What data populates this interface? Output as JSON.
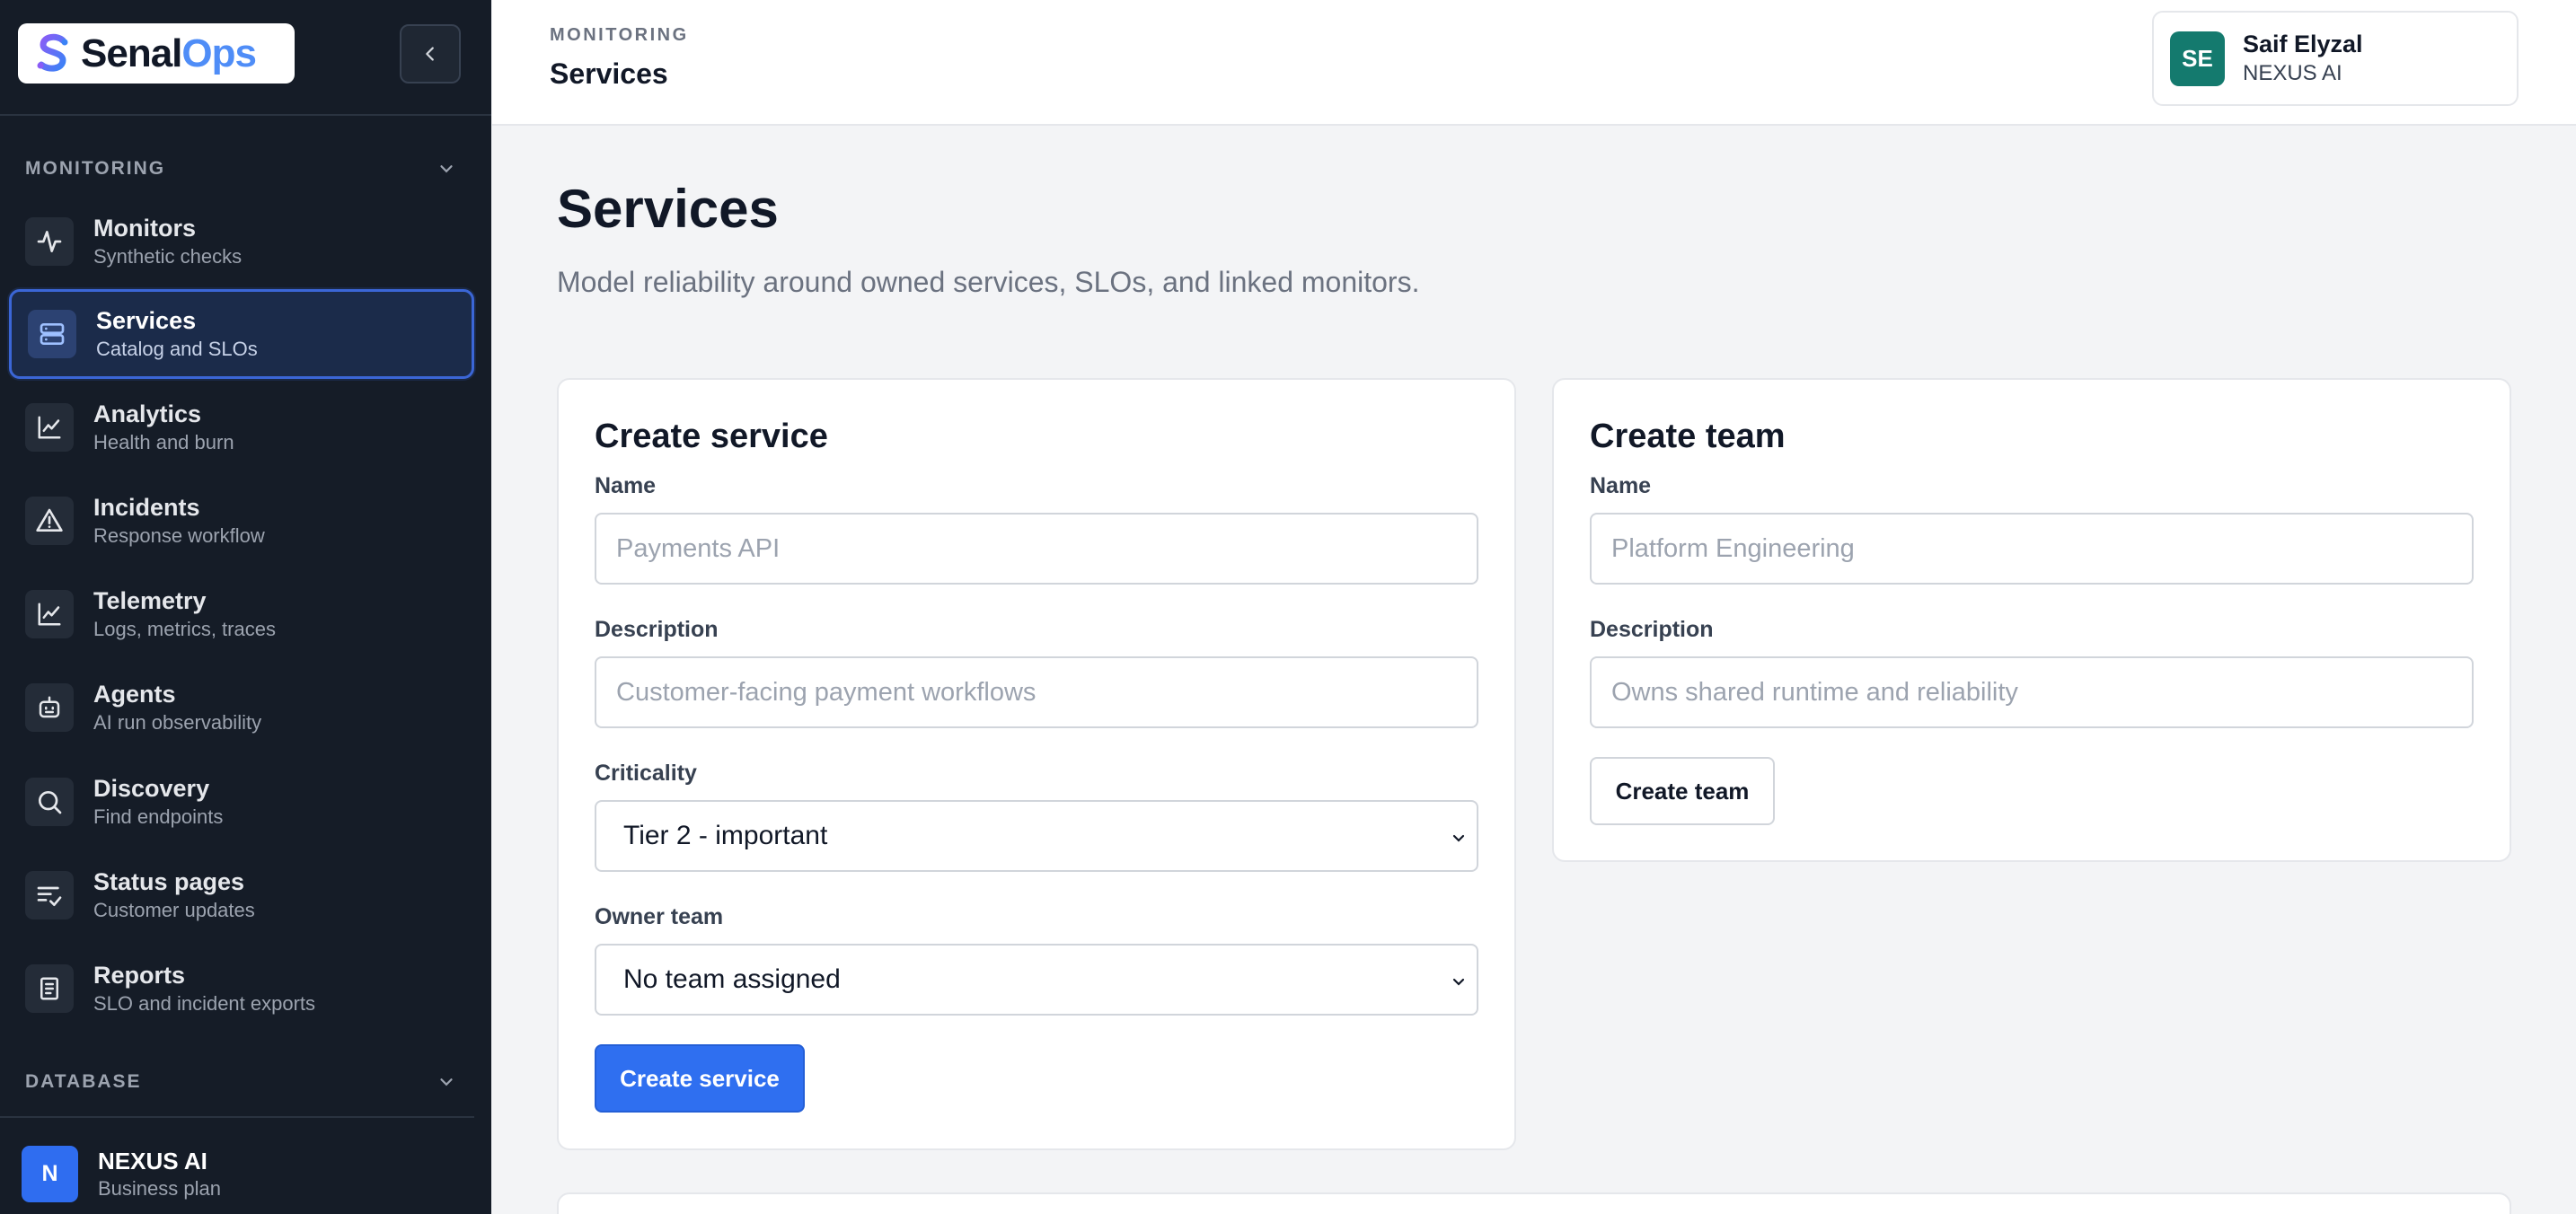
{
  "app": {
    "logo_word_a": "Senal",
    "logo_word_b": "Ops"
  },
  "sidebar": {
    "monitoring_section": "MONITORING",
    "database_section": "DATABASE",
    "items": [
      {
        "label": "Monitors",
        "sub": "Synthetic checks",
        "icon": "activity-icon"
      },
      {
        "label": "Services",
        "sub": "Catalog and SLOs",
        "icon": "server-icon",
        "active": true
      },
      {
        "label": "Analytics",
        "sub": "Health and burn",
        "icon": "line-chart-icon"
      },
      {
        "label": "Incidents",
        "sub": "Response workflow",
        "icon": "alert-triangle-icon"
      },
      {
        "label": "Telemetry",
        "sub": "Logs, metrics, traces",
        "icon": "line-chart-icon"
      },
      {
        "label": "Agents",
        "sub": "AI run observability",
        "icon": "bot-icon"
      },
      {
        "label": "Discovery",
        "sub": "Find endpoints",
        "icon": "search-icon"
      },
      {
        "label": "Status pages",
        "sub": "Customer updates",
        "icon": "list-check-icon"
      },
      {
        "label": "Reports",
        "sub": "SLO and incident exports",
        "icon": "document-icon"
      }
    ],
    "org": {
      "initial": "N",
      "name": "NEXUS AI",
      "plan": "Business plan"
    }
  },
  "header": {
    "eyebrow": "MONITORING",
    "title": "Services",
    "user": {
      "initials": "SE",
      "name": "Saif Elyzal",
      "org": "NEXUS AI"
    }
  },
  "main": {
    "title": "Services",
    "subtitle": "Model reliability around owned services, SLOs, and linked monitors."
  },
  "create_service": {
    "title": "Create service",
    "name_label": "Name",
    "name_placeholder": "Payments API",
    "description_label": "Description",
    "description_placeholder": "Customer-facing payment workflows",
    "criticality_label": "Criticality",
    "criticality_value": "Tier 2 - important",
    "owner_label": "Owner team",
    "owner_value": "No team assigned",
    "submit_label": "Create service"
  },
  "create_team": {
    "title": "Create team",
    "name_label": "Name",
    "name_placeholder": "Platform Engineering",
    "description_label": "Description",
    "description_placeholder": "Owns shared runtime and reliability",
    "submit_label": "Create team"
  },
  "colors": {
    "sidebar_bg": "#151c27",
    "accent": "#2f6ff0",
    "user_avatar": "#147a6e"
  }
}
